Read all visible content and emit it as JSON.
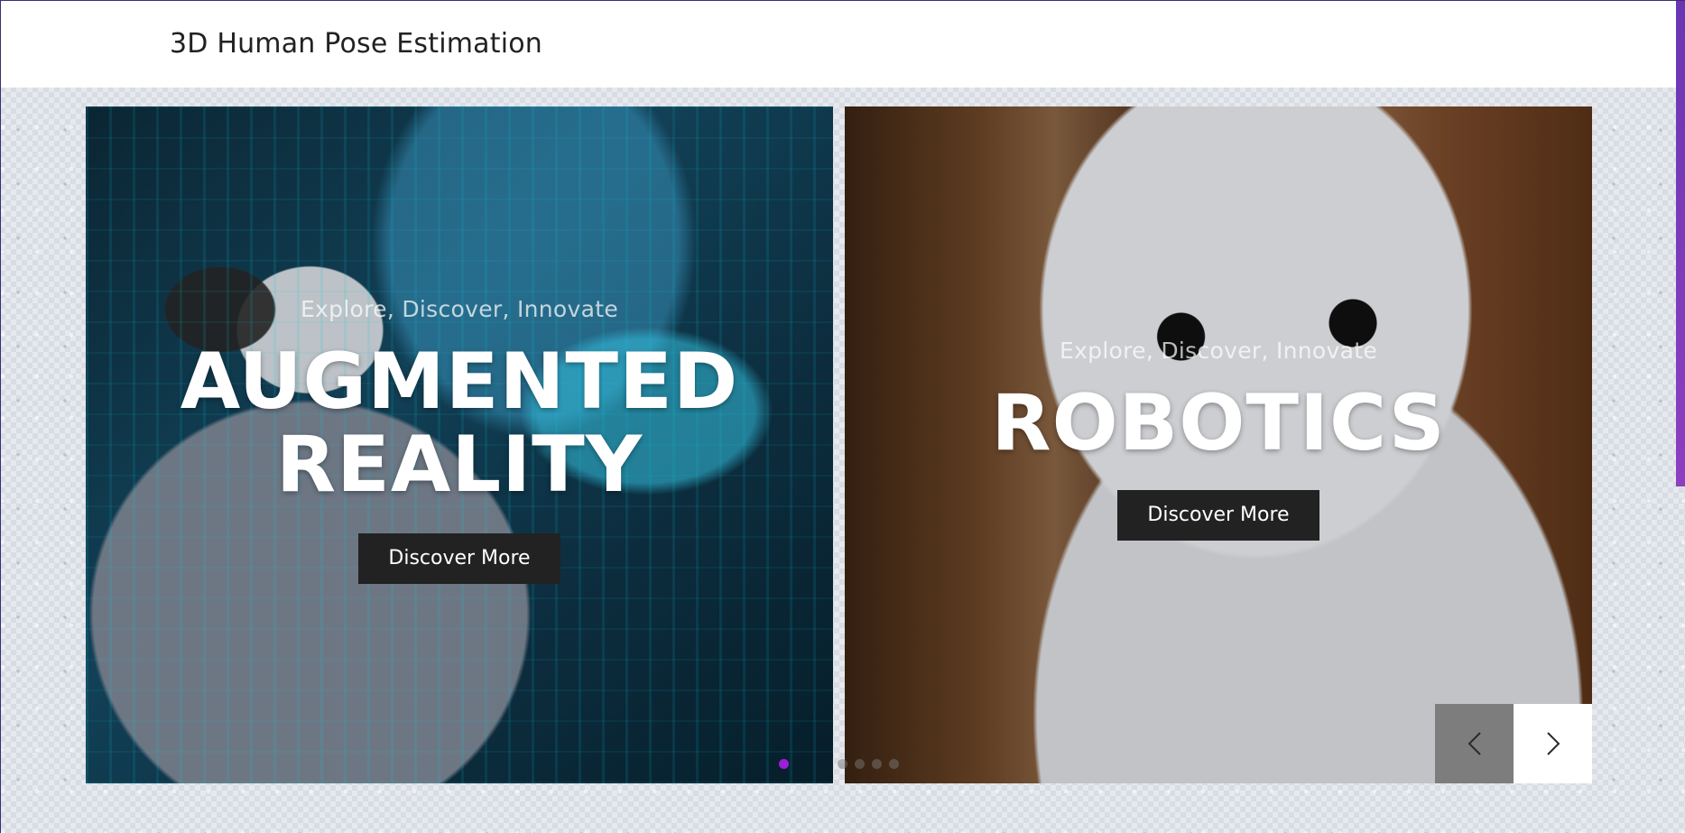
{
  "header": {
    "title": "3D Human Pose Estimation"
  },
  "slides": [
    {
      "tagline": "Explore, Discover, Innovate",
      "headline_line1": "AUGMENTED",
      "headline_line2": "REALITY",
      "button_label": "Discover More",
      "image": "person-wearing-vr-headset"
    },
    {
      "tagline": "Explore, Discover, Innovate",
      "headline_line1": "ROBOTICS",
      "button_label": "Discover More",
      "image": "humanoid-robot"
    }
  ],
  "carousel": {
    "dot_count": 5,
    "active_dot": 0,
    "prev_icon": "chevron-left-icon",
    "next_icon": "chevron-right-icon"
  },
  "colors": {
    "accent": "#9b1fd6",
    "button_bg": "#222222",
    "sidebar_accent": "#7a3ab8"
  }
}
